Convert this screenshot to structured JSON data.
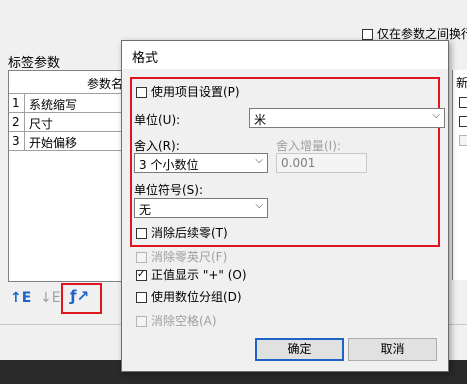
{
  "background_window": {
    "group_title": "标签参数",
    "only_between_label": "仅在参数之间换行",
    "col_header_params": "参数名",
    "right_header_partial": "新",
    "rows": [
      {
        "num": "1",
        "name": "系统缩写"
      },
      {
        "num": "2",
        "name": "尺寸"
      },
      {
        "num": "3",
        "name": "开始偏移"
      }
    ]
  },
  "dialog": {
    "title": "格式",
    "use_project_settings": "使用项目设置(P)",
    "unit_label": "单位(U):",
    "unit_value": "米",
    "rounding_label": "舍入(R):",
    "rounding_value": "3 个小数位",
    "rounding_increment_label": "舍入增量(I):",
    "rounding_increment_value": "0.001",
    "unit_symbol_label": "单位符号(S):",
    "unit_symbol_value": "无",
    "suppress_trailing_zeros": "消除后续零(T)",
    "suppress_zero_feet": "消除零英尺(F)",
    "show_plus_sign": "正值显示 \"+\" (O)",
    "use_digit_grouping": "使用数位分组(D)",
    "suppress_spaces": "消除空格(A)",
    "ok": "确定",
    "cancel": "取消"
  },
  "colors": {
    "highlight": "#e0151e",
    "accent": "#1e64c8"
  }
}
